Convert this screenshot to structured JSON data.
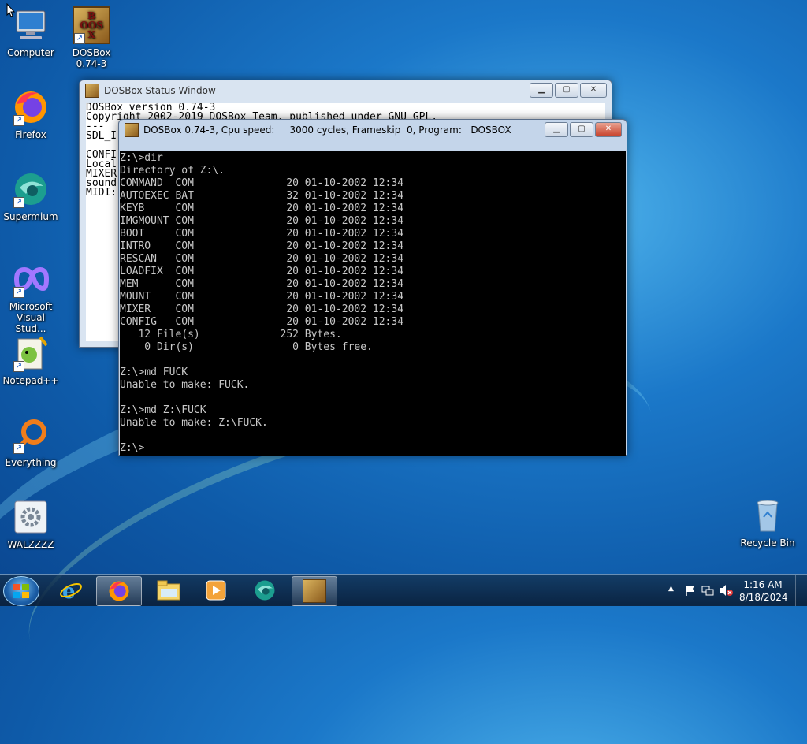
{
  "desktop": {
    "icons": [
      {
        "label": "Computer",
        "icon": "computer-icon"
      },
      {
        "label": "DOSBox\n0.74-3",
        "icon": "dosbox-icon"
      },
      {
        "label": "Firefox",
        "icon": "firefox-icon"
      },
      {
        "label": "Supermium",
        "icon": "supermium-icon"
      },
      {
        "label": "Microsoft\nVisual Stud...",
        "icon": "visual-studio-icon"
      },
      {
        "label": "Notepad++",
        "icon": "notepadpp-icon"
      },
      {
        "label": "Everything",
        "icon": "everything-icon"
      },
      {
        "label": "WALZZZZ",
        "icon": "settings-app-icon"
      },
      {
        "label": "Recycle Bin",
        "icon": "recycle-bin-icon"
      }
    ],
    "logo_text": [
      "B",
      "O",
      "X",
      "D",
      "O",
      "S"
    ]
  },
  "status_window": {
    "title": "DOSBox Status Window",
    "lines": [
      "DOSBox version 0.74-3",
      "Copyright 2002-2019 DOSBox Team, published under GNU GPL.",
      "---",
      "SDL_I",
      "",
      "CONFI",
      "Local",
      "MIXER",
      "sound",
      "MIDI:"
    ]
  },
  "dos_window": {
    "title": "DOSBox 0.74-3, Cpu speed:     3000 cycles, Frameskip  0, Program:   DOSBOX",
    "lines": [
      "Z:\\>dir",
      "Directory of Z:\\.",
      "COMMAND  COM               20 01-10-2002 12:34",
      "AUTOEXEC BAT               32 01-10-2002 12:34",
      "KEYB     COM               20 01-10-2002 12:34",
      "IMGMOUNT COM               20 01-10-2002 12:34",
      "BOOT     COM               20 01-10-2002 12:34",
      "INTRO    COM               20 01-10-2002 12:34",
      "RESCAN   COM               20 01-10-2002 12:34",
      "LOADFIX  COM               20 01-10-2002 12:34",
      "MEM      COM               20 01-10-2002 12:34",
      "MOUNT    COM               20 01-10-2002 12:34",
      "MIXER    COM               20 01-10-2002 12:34",
      "CONFIG   COM               20 01-10-2002 12:34",
      "   12 File(s)             252 Bytes.",
      "    0 Dir(s)                0 Bytes free.",
      "",
      "Z:\\>md FUCK",
      "Unable to make: FUCK.",
      "",
      "Z:\\>md Z:\\FUCK",
      "Unable to make: Z:\\FUCK.",
      "",
      "Z:\\>"
    ]
  },
  "window_controls": {
    "minimize": "▁",
    "maximize": "▢",
    "close": "✕"
  },
  "taskbar": {
    "items": [
      "internet-explorer-icon",
      "firefox-icon",
      "file-explorer-icon",
      "media-player-icon",
      "supermium-icon",
      "dosbox-icon"
    ],
    "tray_chevron": "▲",
    "time": "1:16 AM",
    "date": "8/18/2024"
  },
  "colors": {
    "console_text": "#c8c8c8",
    "console_bg": "#000000",
    "taskbar": "#1c3450"
  }
}
